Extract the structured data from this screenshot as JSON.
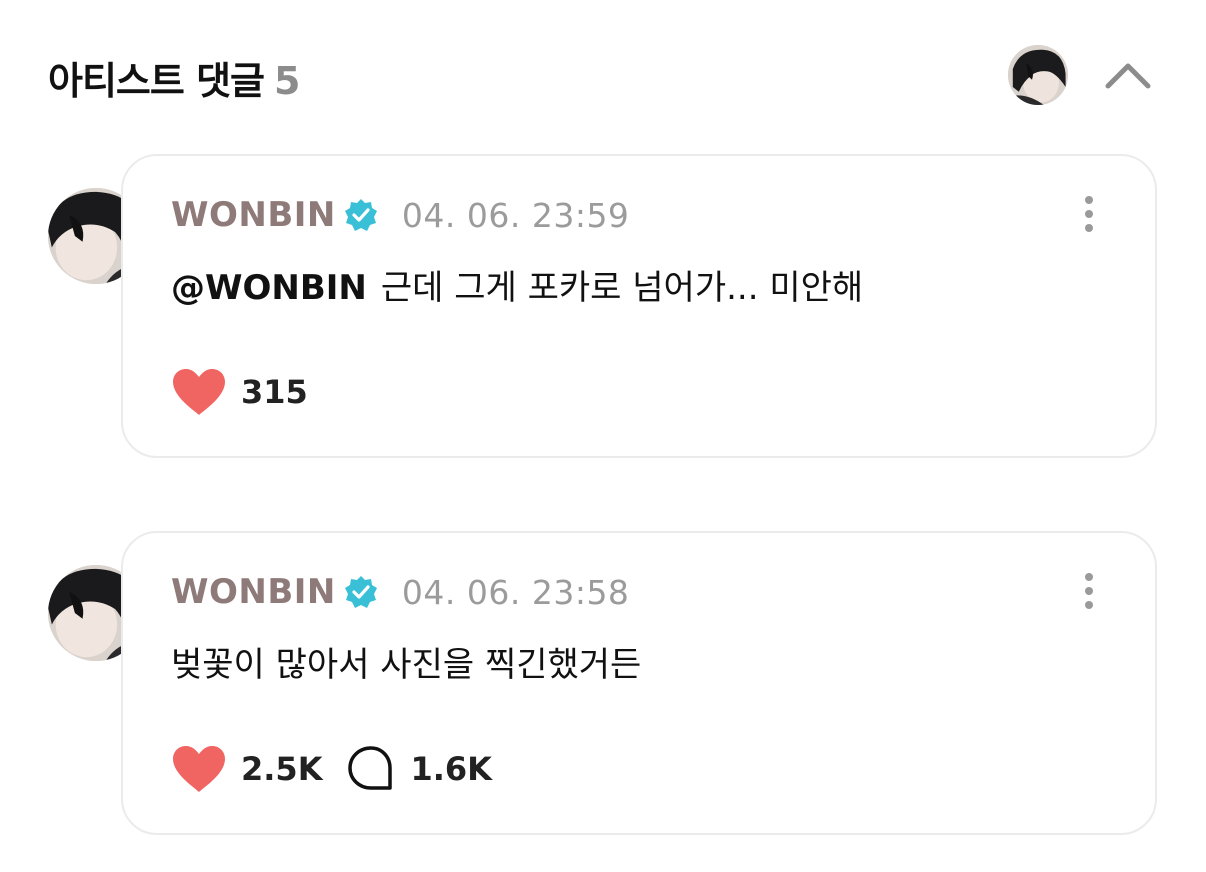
{
  "header": {
    "title": "아티스트 댓글",
    "count": "5"
  },
  "comments": [
    {
      "author": "WONBIN",
      "time": "04. 06. 23:59",
      "mention": "@WONBIN",
      "text": "근데 그게 포카로 넘어가... 미안해",
      "likes": "315"
    },
    {
      "author": "WONBIN",
      "time": "04. 06. 23:58",
      "mention": "",
      "text": "벚꽃이 많아서 사진을 찍긴했거든",
      "likes": "2.5K",
      "replies": "1.6K"
    }
  ],
  "icons": {
    "verified": "verified-badge-icon",
    "like": "heart-icon",
    "reply": "speech-bubble-icon",
    "more": "more-vertical-icon",
    "collapse": "chevron-up-icon"
  },
  "colors": {
    "author": "#8e7a78",
    "verified": "#39c0d6",
    "heart": "#f06562",
    "muted": "#9b9b9b",
    "card_border": "#ebebeb"
  }
}
